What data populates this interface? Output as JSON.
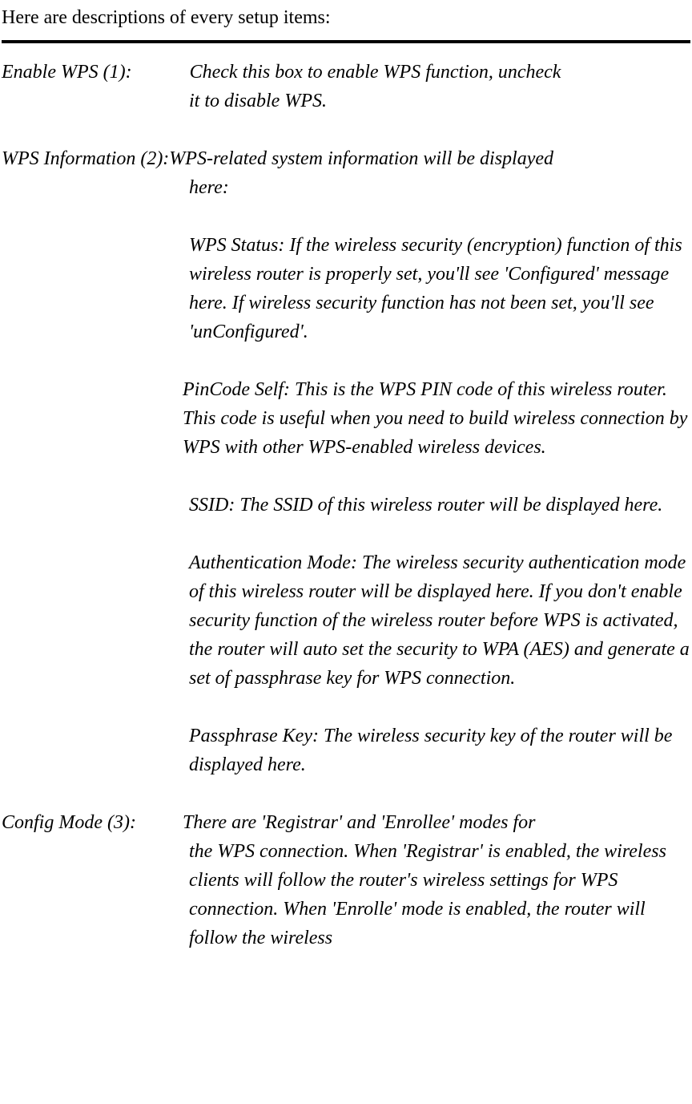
{
  "intro": "Here are descriptions of every setup items:",
  "items": [
    {
      "label": "Enable WPS (1):",
      "desc_first": "Check this box to enable WPS function, uncheck it to disable WPS.",
      "blocks": []
    },
    {
      "label": "WPS Information (2):",
      "desc_first": "WPS-related system information will be displayed here:",
      "blocks": [
        "WPS Status: If the wireless security (encryption) function of this wireless router is properly set, you'll see 'Configured' message here. If wireless security function has not been set, you'll see 'unConfigured'.",
        "PinCode Self: This is the WPS PIN code of this wireless router. This code is useful when you need to build wireless connection by WPS with other WPS-enabled wireless devices.",
        "SSID: The SSID of this wireless router will be displayed here.",
        "Authentication Mode: The wireless security authentication mode of this wireless router will be displayed here. If you don't enable security function of the wireless router before WPS is activated, the router will auto set the security to WPA (AES) and generate a set of passphrase key for WPS connection.",
        "Passphrase Key: The wireless security key of the router will be displayed here."
      ]
    },
    {
      "label": "Config Mode (3):",
      "desc_first": "There are 'Registrar' and 'Enrollee' modes for the WPS connection. When 'Registrar' is enabled, the wireless clients will follow the router's wireless settings for WPS connection. When 'Enrolle' mode is enabled, the router will follow the wireless",
      "blocks": []
    }
  ]
}
